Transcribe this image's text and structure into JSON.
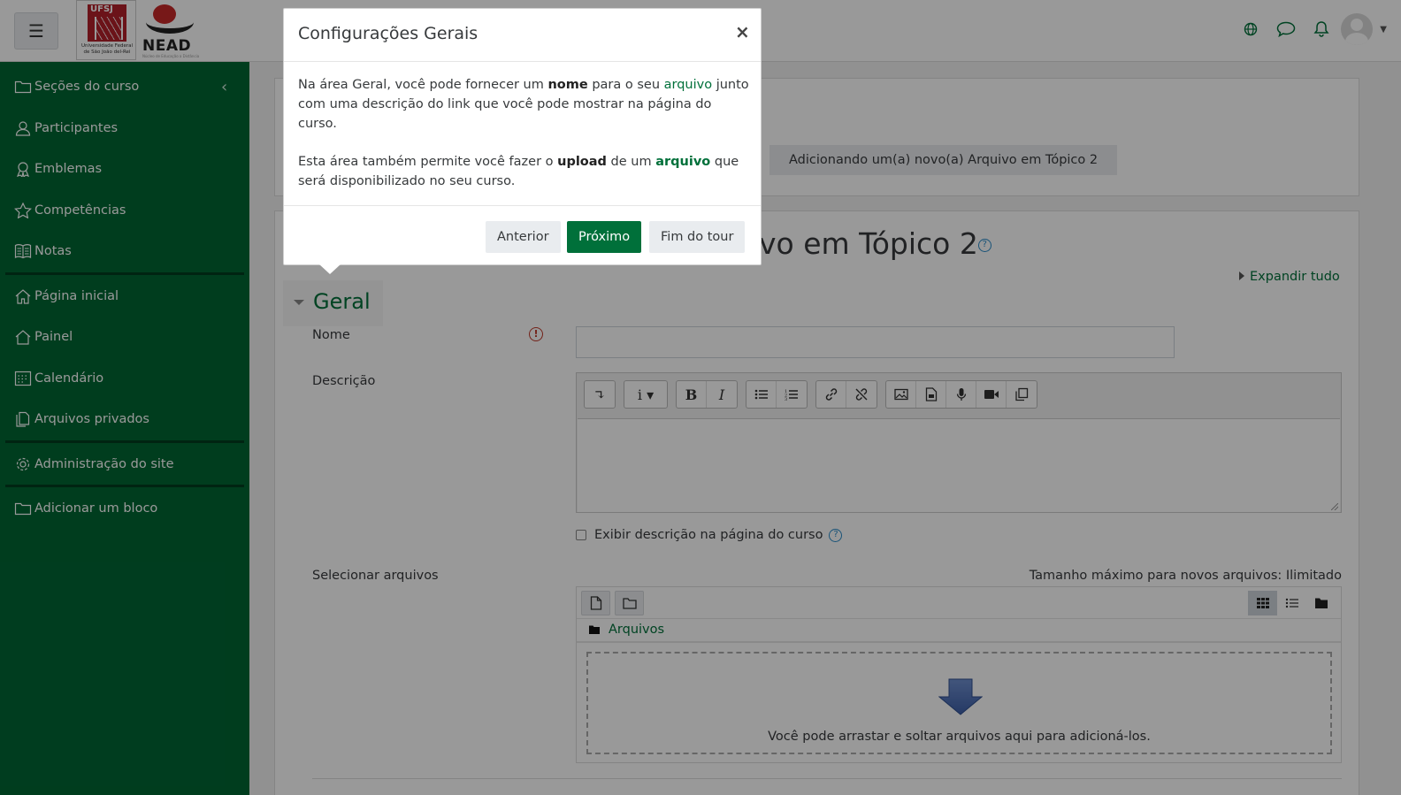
{
  "navbar": {
    "menu_icon": "hamburger-icon",
    "logo_ufsj": {
      "abbr": "UFSJ",
      "caption": "Universidade Federal de São João del-Rei"
    },
    "logo_nead": {
      "name": "NEAD",
      "tagline": "Núcleo de Educação a Distância"
    },
    "icons": [
      "globe-icon",
      "message-icon",
      "bell-icon",
      "user-avatar"
    ]
  },
  "sidebar": {
    "items": [
      {
        "label": "Seções do curso",
        "icon": "folder-icon"
      },
      {
        "label": "Participantes",
        "icon": "users-icon"
      },
      {
        "label": "Emblemas",
        "icon": "badge-icon"
      },
      {
        "label": "Competências",
        "icon": "star-icon"
      },
      {
        "label": "Notas",
        "icon": "grades-icon"
      },
      {
        "label": "Página inicial",
        "icon": "home-icon"
      },
      {
        "label": "Painel",
        "icon": "dashboard-icon"
      },
      {
        "label": "Calendário",
        "icon": "calendar-icon"
      },
      {
        "label": "Arquivos privados",
        "icon": "files-icon"
      },
      {
        "label": "Administração do site",
        "icon": "gear-icon"
      },
      {
        "label": "Adicionar um bloco",
        "icon": "folder-icon"
      }
    ],
    "color": "#006633"
  },
  "breadcrumb": {
    "current": "Adicionando um(a) novo(a) Arquivo em Tópico 2"
  },
  "page": {
    "title_visible": "vo em Tópico 2",
    "expand_all": "Expandir tudo"
  },
  "form": {
    "section": "Geral",
    "name_label": "Nome",
    "name_value": "",
    "description_label": "Descrição",
    "show_description_label": "Exibir descrição na página do curso",
    "select_files_label": "Selecionar arquivos",
    "max_size": "Tamanho máximo para novos arquivos: Ilimitado",
    "files_folder": "Arquivos",
    "dropzone_text": "Você pode arrastar e soltar arquivos aqui para adicioná-los."
  },
  "tour": {
    "title": "Configurações Gerais",
    "p1_a": "Na área Geral, você pode fornecer um ",
    "p1_b": "nome",
    "p1_c": " para o seu ",
    "p1_d": "arquivo",
    "p1_e": " junto com uma descrição do link que você pode mostrar na página do curso.",
    "p2_a": "Esta área também permite você fazer o ",
    "p2_b": "upload",
    "p2_c": " de um ",
    "p2_d": "arquivo",
    "p2_e": " que será disponibilizado no seu curso.",
    "prev": "Anterior",
    "next": "Próximo",
    "end": "Fim do tour"
  },
  "colors": {
    "accent": "#00703a",
    "sidebar": "#006633",
    "link_help": "#2a8bc9",
    "required": "#c0392b"
  }
}
